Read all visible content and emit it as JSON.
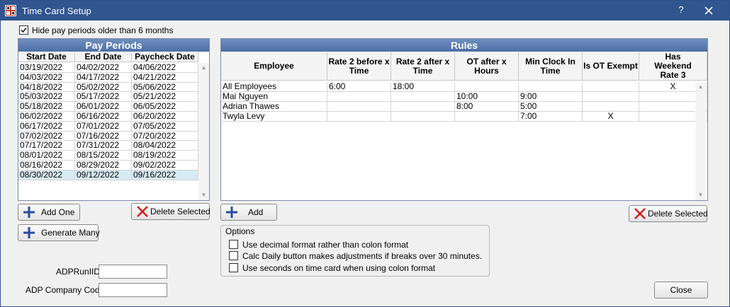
{
  "window": {
    "title": "Time Card Setup",
    "help_label": "?"
  },
  "hide_old_periods": {
    "label": "Hide pay periods older than 6 months",
    "checked": true
  },
  "pay_periods": {
    "header": "Pay Periods",
    "columns": [
      "Start Date",
      "End Date",
      "Paycheck Date"
    ],
    "rows": [
      [
        "03/19/2022",
        "04/02/2022",
        "04/06/2022"
      ],
      [
        "04/03/2022",
        "04/17/2022",
        "04/21/2022"
      ],
      [
        "04/18/2022",
        "05/02/2022",
        "05/06/2022"
      ],
      [
        "05/03/2022",
        "05/17/2022",
        "05/21/2022"
      ],
      [
        "05/18/2022",
        "06/01/2022",
        "06/05/2022"
      ],
      [
        "06/02/2022",
        "06/16/2022",
        "06/20/2022"
      ],
      [
        "06/17/2022",
        "07/01/2022",
        "07/05/2022"
      ],
      [
        "07/02/2022",
        "07/16/2022",
        "07/20/2022"
      ],
      [
        "07/17/2022",
        "07/31/2022",
        "08/04/2022"
      ],
      [
        "08/01/2022",
        "08/15/2022",
        "08/19/2022"
      ],
      [
        "08/16/2022",
        "08/29/2022",
        "09/02/2022"
      ],
      [
        "08/30/2022",
        "09/12/2022",
        "09/16/2022"
      ]
    ],
    "selected_row": 11,
    "add_one_label": "Add One",
    "delete_label": "Delete Selected",
    "generate_label": "Generate Many"
  },
  "adp": {
    "run_id_label": "ADPRunIID",
    "run_id_value": "",
    "company_code_label": "ADP Company Code",
    "company_code_value": ""
  },
  "rules": {
    "header": "Rules",
    "columns": [
      [
        "Employee"
      ],
      [
        "Rate 2 before x",
        "Time"
      ],
      [
        "Rate 2 after x",
        "Time"
      ],
      [
        "OT after x",
        "Hours"
      ],
      [
        "Min Clock In",
        "Time"
      ],
      [
        "Is OT Exempt"
      ],
      [
        "Has",
        "Weekend",
        "Rate 3"
      ]
    ],
    "rows": [
      [
        "All Employees",
        "6:00",
        "18:00",
        "",
        "",
        "",
        "X"
      ],
      [
        "Mai Nguyen",
        "",
        "",
        "10:00",
        "9:00",
        "",
        ""
      ],
      [
        "Adrian Thawes",
        "",
        "",
        "8:00",
        "5:00",
        "",
        ""
      ],
      [
        "Twyla Levy",
        "",
        "",
        "",
        "7:00",
        "X",
        ""
      ]
    ],
    "add_label": "Add",
    "delete_label": "Delete Selected"
  },
  "options": {
    "title": "Options",
    "items": [
      {
        "label": "Use decimal format rather than colon format",
        "checked": false
      },
      {
        "label": "Calc Daily button makes adjustments if breaks over 30 minutes.",
        "checked": false
      },
      {
        "label": "Use seconds on time card when using colon format",
        "checked": false
      }
    ]
  },
  "close_label": "Close",
  "colors": {
    "title_bar": "#30558f",
    "panel_header": "#5a7cb2",
    "selection": "#d7ebf5",
    "add_icon": "#2a4a9a",
    "delete_icon": "#d42020"
  }
}
